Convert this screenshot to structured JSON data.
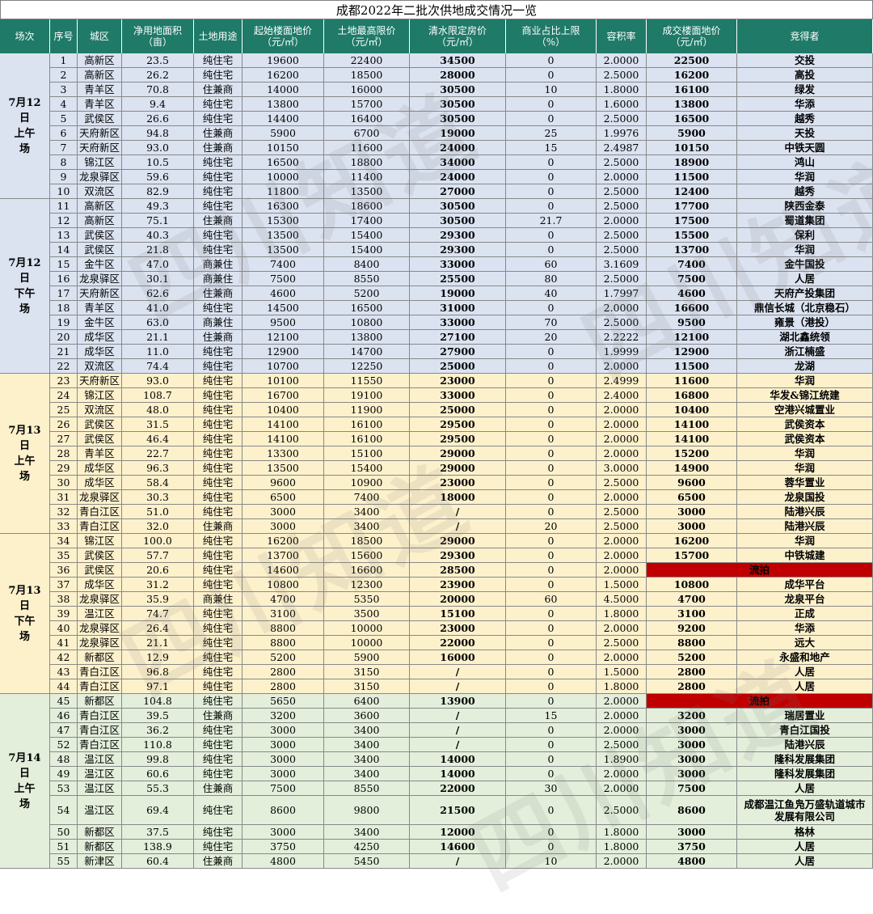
{
  "title": "成都2022年二批次供地成交情况一览",
  "headers": [
    "场次",
    "序号",
    "城区",
    "净用地面积\n（亩）",
    "土地用途",
    "起始楼面地价\n（元/㎡）",
    "土地最高限价\n（元/㎡）",
    "清水限定房价\n（元/㎡）",
    "商业占比上限\n（%）",
    "容积率",
    "成交楼面地价\n（元/㎡）",
    "竞得者"
  ],
  "watermark": "四川知道",
  "colors": {
    "header": "#1f7a68",
    "blue": "#dbe3f1",
    "yellow": "#fdf1cc",
    "green": "#e3efdb",
    "failed": "#c00000"
  },
  "sessions": [
    {
      "label": "7月12\n日\n上午\n场",
      "color": "blue",
      "rows": [
        [
          "1",
          "高新区",
          "23.5",
          "纯住宅",
          "19600",
          "22400",
          "34500",
          "0",
          "2.0000",
          "22500",
          "交投"
        ],
        [
          "2",
          "高新区",
          "26.2",
          "纯住宅",
          "16200",
          "18500",
          "28000",
          "0",
          "2.5000",
          "16200",
          "高投"
        ],
        [
          "3",
          "青羊区",
          "70.8",
          "住兼商",
          "14000",
          "16000",
          "30500",
          "10",
          "1.8000",
          "16100",
          "绿发"
        ],
        [
          "4",
          "青羊区",
          "9.4",
          "纯住宅",
          "13800",
          "15700",
          "30500",
          "0",
          "1.6000",
          "13800",
          "华添"
        ],
        [
          "5",
          "武侯区",
          "26.6",
          "纯住宅",
          "14400",
          "16400",
          "30500",
          "0",
          "2.5000",
          "16500",
          "越秀"
        ],
        [
          "6",
          "天府新区",
          "94.8",
          "住兼商",
          "5900",
          "6700",
          "19000",
          "25",
          "1.9976",
          "5900",
          "天投"
        ],
        [
          "7",
          "天府新区",
          "93.0",
          "住兼商",
          "10150",
          "11600",
          "24000",
          "15",
          "2.4987",
          "10150",
          "中铁天圆"
        ],
        [
          "8",
          "锦江区",
          "10.5",
          "纯住宅",
          "16500",
          "18800",
          "34000",
          "0",
          "2.5000",
          "18900",
          "鸿山"
        ],
        [
          "9",
          "龙泉驿区",
          "59.6",
          "纯住宅",
          "10000",
          "11400",
          "24000",
          "0",
          "2.0000",
          "11500",
          "华润"
        ],
        [
          "10",
          "双流区",
          "82.9",
          "纯住宅",
          "11800",
          "13500",
          "27000",
          "0",
          "2.5000",
          "12400",
          "越秀"
        ]
      ]
    },
    {
      "label": "7月12\n日\n下午\n场",
      "color": "blue",
      "rows": [
        [
          "11",
          "高新区",
          "49.3",
          "纯住宅",
          "16300",
          "18600",
          "30500",
          "0",
          "2.5000",
          "17700",
          "陕西金泰"
        ],
        [
          "12",
          "高新区",
          "75.1",
          "住兼商",
          "15300",
          "17400",
          "30500",
          "21.7",
          "2.0000",
          "17500",
          "蜀道集团"
        ],
        [
          "13",
          "武侯区",
          "40.3",
          "纯住宅",
          "13500",
          "15400",
          "29300",
          "0",
          "2.5000",
          "15500",
          "保利"
        ],
        [
          "14",
          "武侯区",
          "21.8",
          "纯住宅",
          "13500",
          "15400",
          "29300",
          "0",
          "2.5000",
          "13700",
          "华润"
        ],
        [
          "15",
          "金牛区",
          "47.0",
          "商兼住",
          "7400",
          "8400",
          "33000",
          "60",
          "3.1609",
          "7400",
          "金牛国投"
        ],
        [
          "16",
          "龙泉驿区",
          "30.1",
          "商兼住",
          "7500",
          "8550",
          "25500",
          "80",
          "2.5000",
          "7500",
          "人居"
        ],
        [
          "17",
          "天府新区",
          "62.6",
          "住兼商",
          "4600",
          "5200",
          "19000",
          "40",
          "1.7997",
          "4600",
          "天府产投集团"
        ],
        [
          "18",
          "青羊区",
          "41.0",
          "纯住宅",
          "14500",
          "16500",
          "31000",
          "0",
          "2.0000",
          "16600",
          "鼎信长城（北京稳石）"
        ],
        [
          "19",
          "金牛区",
          "63.0",
          "商兼住",
          "9500",
          "10800",
          "33000",
          "70",
          "2.5000",
          "9500",
          "雍景（港投）"
        ],
        [
          "20",
          "成华区",
          "21.1",
          "住兼商",
          "12100",
          "13800",
          "27100",
          "20",
          "2.2222",
          "12100",
          "湖北鑫统领"
        ],
        [
          "21",
          "成华区",
          "11.0",
          "纯住宅",
          "12900",
          "14700",
          "27900",
          "0",
          "1.9999",
          "12900",
          "浙江楠盛"
        ],
        [
          "22",
          "双流区",
          "74.4",
          "纯住宅",
          "10700",
          "12250",
          "25000",
          "0",
          "2.0000",
          "11500",
          "龙湖"
        ]
      ]
    },
    {
      "label": "7月13\n日\n上午\n场",
      "color": "yellow",
      "rows": [
        [
          "23",
          "天府新区",
          "93.0",
          "纯住宅",
          "10100",
          "11550",
          "23000",
          "0",
          "2.4999",
          "11600",
          "华润"
        ],
        [
          "24",
          "锦江区",
          "108.7",
          "纯住宅",
          "16700",
          "19100",
          "33000",
          "0",
          "2.4000",
          "16800",
          "华发&锦江统建"
        ],
        [
          "25",
          "双流区",
          "48.0",
          "纯住宅",
          "10400",
          "11900",
          "25000",
          "0",
          "2.0000",
          "10400",
          "空港兴城置业"
        ],
        [
          "26",
          "武侯区",
          "31.5",
          "纯住宅",
          "14100",
          "16100",
          "29500",
          "0",
          "2.0000",
          "14100",
          "武侯资本"
        ],
        [
          "27",
          "武侯区",
          "46.4",
          "纯住宅",
          "14100",
          "16100",
          "29500",
          "0",
          "2.0000",
          "14100",
          "武侯资本"
        ],
        [
          "28",
          "青羊区",
          "22.7",
          "纯住宅",
          "13300",
          "15100",
          "29000",
          "0",
          "2.0000",
          "15200",
          "华润"
        ],
        [
          "29",
          "成华区",
          "96.3",
          "纯住宅",
          "13500",
          "15400",
          "29000",
          "0",
          "3.0000",
          "14900",
          "华润"
        ],
        [
          "30",
          "成华区",
          "58.4",
          "纯住宅",
          "9600",
          "10900",
          "23000",
          "0",
          "2.5000",
          "9600",
          "蓉华置业"
        ],
        [
          "31",
          "龙泉驿区",
          "30.3",
          "纯住宅",
          "6500",
          "7400",
          "18000",
          "0",
          "2.0000",
          "6500",
          "龙泉国投"
        ],
        [
          "32",
          "青白江区",
          "51.0",
          "纯住宅",
          "3000",
          "3400",
          "/",
          "0",
          "2.5000",
          "3000",
          "陆港兴辰"
        ],
        [
          "33",
          "青白江区",
          "32.0",
          "住兼商",
          "3000",
          "3400",
          "/",
          "20",
          "2.5000",
          "3000",
          "陆港兴辰"
        ]
      ]
    },
    {
      "label": "7月13\n日\n下午\n场",
      "color": "yellow",
      "rows": [
        [
          "34",
          "锦江区",
          "100.0",
          "纯住宅",
          "16200",
          "18500",
          "29000",
          "0",
          "2.0000",
          "16200",
          "华润"
        ],
        [
          "35",
          "武侯区",
          "57.7",
          "纯住宅",
          "13700",
          "15600",
          "29300",
          "0",
          "2.0000",
          "15700",
          "中铁城建"
        ],
        [
          "36",
          "武侯区",
          "20.6",
          "纯住宅",
          "14600",
          "16600",
          "28500",
          "0",
          "2.0000",
          "流拍",
          ""
        ],
        [
          "37",
          "成华区",
          "31.2",
          "纯住宅",
          "10800",
          "12300",
          "23900",
          "0",
          "1.5000",
          "10800",
          "成华平台"
        ],
        [
          "38",
          "龙泉驿区",
          "35.9",
          "商兼住",
          "4700",
          "5350",
          "20000",
          "60",
          "4.5000",
          "4700",
          "龙泉平台"
        ],
        [
          "39",
          "温江区",
          "74.7",
          "纯住宅",
          "3100",
          "3500",
          "15100",
          "0",
          "1.8000",
          "3100",
          "正成"
        ],
        [
          "40",
          "龙泉驿区",
          "26.4",
          "纯住宅",
          "8800",
          "10000",
          "23000",
          "0",
          "2.0000",
          "9200",
          "华添"
        ],
        [
          "41",
          "龙泉驿区",
          "21.1",
          "纯住宅",
          "8800",
          "10000",
          "22000",
          "0",
          "2.5000",
          "8800",
          "远大"
        ],
        [
          "42",
          "新都区",
          "12.9",
          "纯住宅",
          "5200",
          "5900",
          "16000",
          "0",
          "2.0000",
          "5200",
          "永盛和地产"
        ],
        [
          "43",
          "青白江区",
          "96.8",
          "纯住宅",
          "2800",
          "3150",
          "/",
          "0",
          "1.5000",
          "2800",
          "人居"
        ],
        [
          "44",
          "青白江区",
          "97.1",
          "纯住宅",
          "2800",
          "3150",
          "/",
          "0",
          "1.8000",
          "2800",
          "人居"
        ]
      ]
    },
    {
      "label": "7月14\n日\n上午\n场",
      "color": "green",
      "rows": [
        [
          "45",
          "新都区",
          "104.8",
          "纯住宅",
          "5650",
          "6400",
          "13900",
          "0",
          "2.0000",
          "流拍",
          ""
        ],
        [
          "46",
          "青白江区",
          "39.5",
          "住兼商",
          "3200",
          "3600",
          "/",
          "15",
          "2.0000",
          "3200",
          "瑞居置业"
        ],
        [
          "47",
          "青白江区",
          "36.2",
          "纯住宅",
          "3000",
          "3400",
          "/",
          "0",
          "2.0000",
          "3000",
          "青白江国投"
        ],
        [
          "52",
          "青白江区",
          "110.8",
          "纯住宅",
          "3000",
          "3400",
          "/",
          "0",
          "2.5000",
          "3000",
          "陆港兴辰"
        ],
        [
          "48",
          "温江区",
          "99.8",
          "纯住宅",
          "3000",
          "3400",
          "14000",
          "0",
          "1.8900",
          "3000",
          "隆科发展集团"
        ],
        [
          "49",
          "温江区",
          "60.6",
          "纯住宅",
          "3000",
          "3400",
          "14000",
          "0",
          "2.0000",
          "3000",
          "隆科发展集团"
        ],
        [
          "53",
          "温江区",
          "55.3",
          "住兼商",
          "7500",
          "8550",
          "22000",
          "30",
          "2.0000",
          "7500",
          "人居"
        ],
        [
          "54",
          "温江区",
          "69.4",
          "纯住宅",
          "8600",
          "9800",
          "21500",
          "0",
          "2.5000",
          "8600",
          "成都温江鱼凫万盛轨道城市发展有限公司"
        ],
        [
          "50",
          "新都区",
          "37.5",
          "纯住宅",
          "3000",
          "3400",
          "12000",
          "0",
          "1.8000",
          "3000",
          "格林"
        ],
        [
          "51",
          "新都区",
          "138.9",
          "纯住宅",
          "3750",
          "4250",
          "14600",
          "0",
          "1.8000",
          "3750",
          "人居"
        ],
        [
          "55",
          "新津区",
          "60.4",
          "住兼商",
          "4800",
          "5450",
          "/",
          "10",
          "2.0000",
          "4800",
          "人居"
        ]
      ]
    }
  ]
}
